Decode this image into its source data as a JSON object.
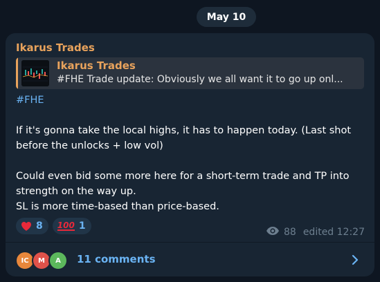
{
  "date_label": "May 10",
  "post": {
    "author": "Ikarus Trades",
    "reply": {
      "author": "Ikarus Trades",
      "text": "#FHE  Trade update: Obviously we all want it to go up onl..."
    },
    "hashtag": "#FHE",
    "paragraphs": [
      "If it's gonna take the local highs, it has to happen today. (Last shot before the unlocks + low vol)",
      "Could even bid some more here for a short-term trade and TP into strength on the way up.",
      "SL is more time-based than price-based."
    ],
    "reactions": [
      {
        "emoji": "heart",
        "count": "8"
      },
      {
        "emoji": "100",
        "count": "1"
      }
    ],
    "views": "88",
    "edited": "edited 12:27"
  },
  "comments": {
    "avatars": [
      {
        "initials": "IC",
        "color": "#e8873b"
      },
      {
        "initials": "M",
        "color": "#e0524a"
      },
      {
        "initials": "A",
        "color": "#5cb85c"
      }
    ],
    "label": "11 comments"
  },
  "colors": {
    "background": "#0e1621",
    "bubble": "#182533",
    "accent_orange": "#e9a35c",
    "link_blue": "#6ab3f3"
  }
}
